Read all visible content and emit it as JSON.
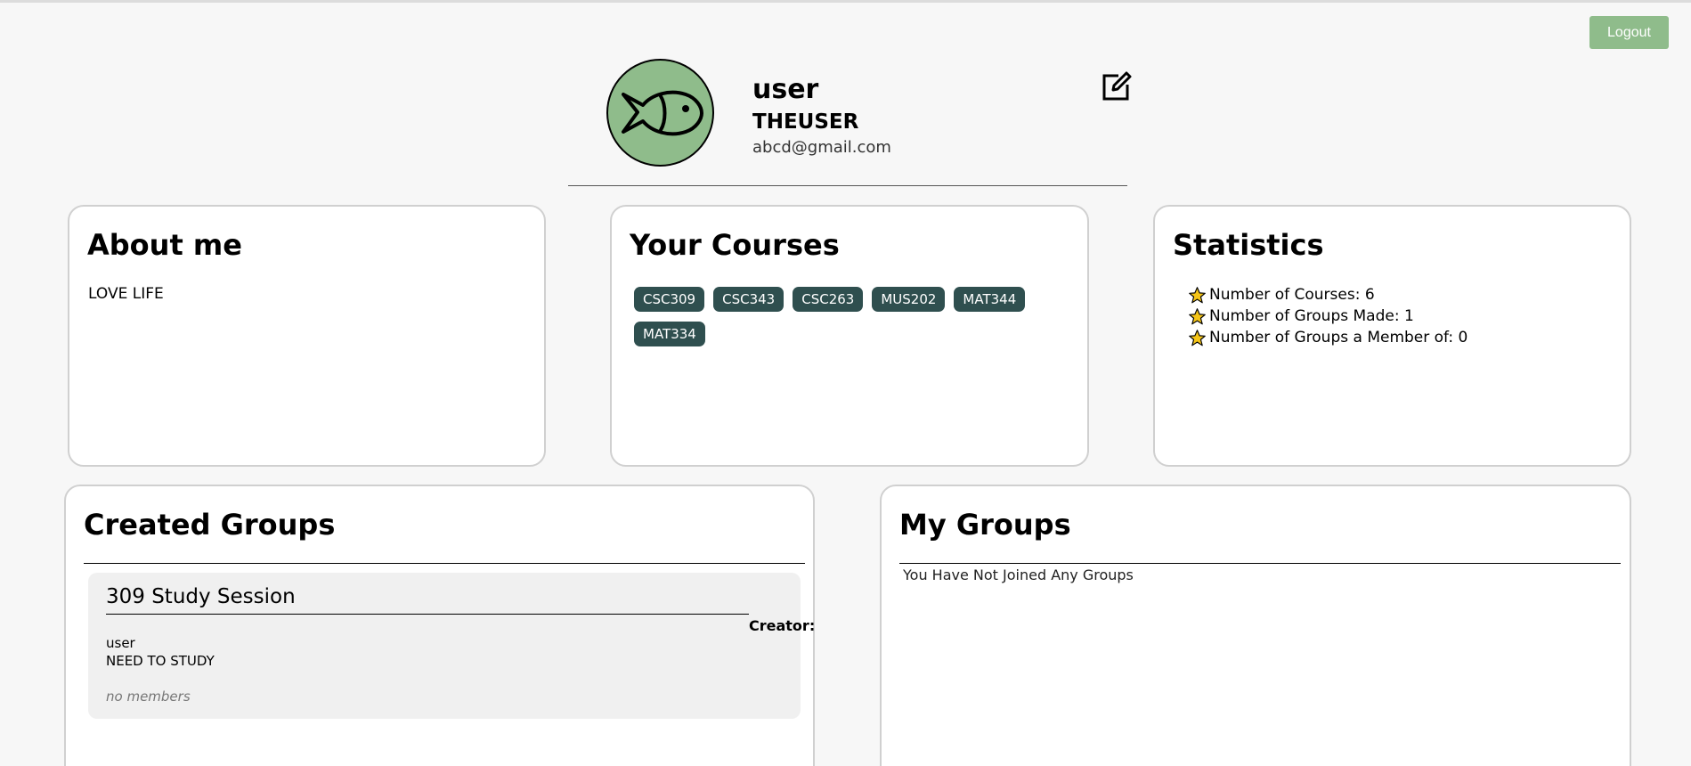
{
  "header": {
    "logout_label": "Logout",
    "username": "user",
    "fullname": "THEUSER",
    "email": "abcd@gmail.com"
  },
  "about": {
    "title": "About me",
    "text": "LOVE LIFE"
  },
  "courses": {
    "title": "Your Courses",
    "items": [
      "CSC309",
      "CSC343",
      "CSC263",
      "MUS202",
      "MAT344",
      "MAT334"
    ]
  },
  "statistics": {
    "title": "Statistics",
    "items": [
      "Number of Courses: 6",
      "Number of Groups Made: 1",
      "Number of Groups a Member of: 0"
    ]
  },
  "created_groups": {
    "title": "Created Groups",
    "groups": [
      {
        "name": "309 Study Session",
        "creator_label": "Creator:",
        "creator": "user",
        "description": "NEED TO STUDY",
        "members": "no members"
      }
    ]
  },
  "my_groups": {
    "title": "My Groups",
    "empty_text": "You Have Not Joined Any Groups"
  },
  "colors": {
    "accent": "#8fbc8b",
    "chip": "#2f4f4f",
    "star": "#f5c518"
  }
}
